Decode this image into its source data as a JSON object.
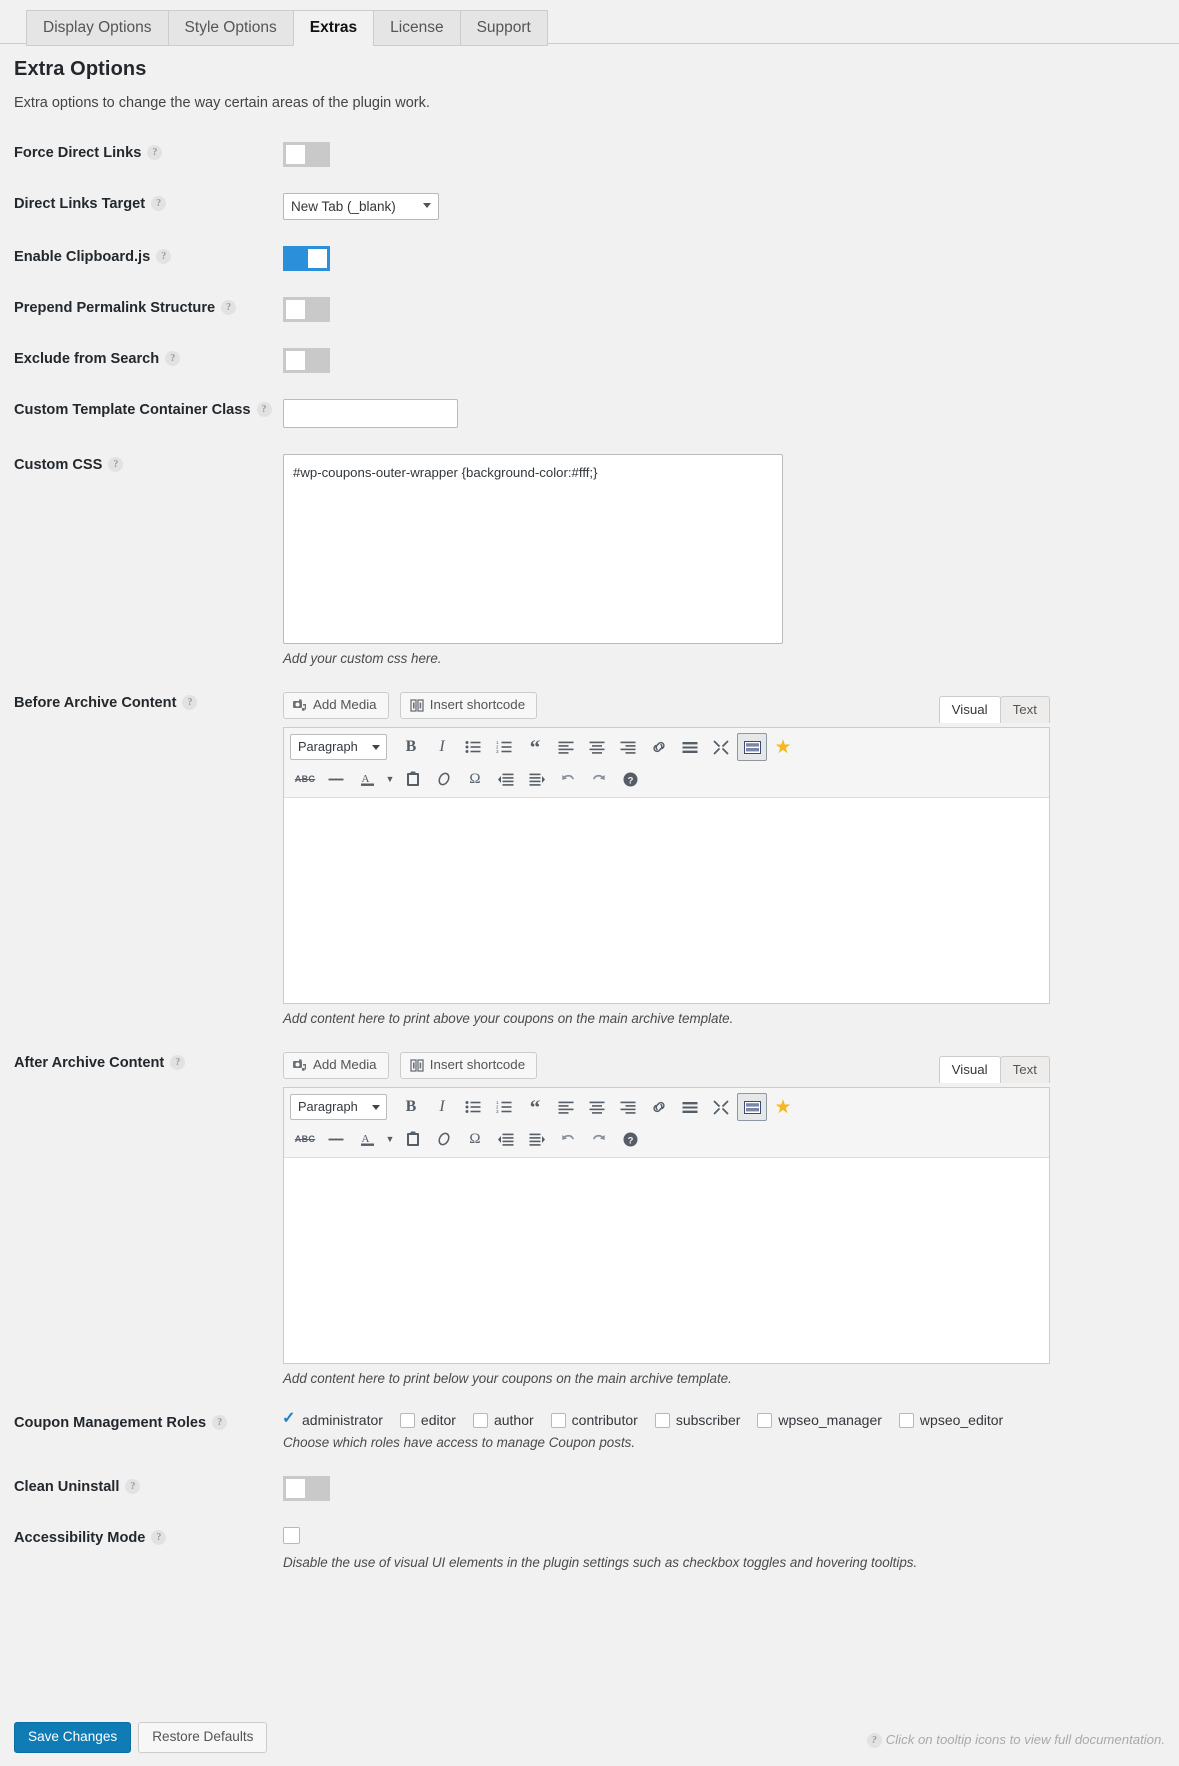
{
  "tabs": [
    {
      "label": "Display Options",
      "active": false
    },
    {
      "label": "Style Options",
      "active": false
    },
    {
      "label": "Extras",
      "active": true
    },
    {
      "label": "License",
      "active": false
    },
    {
      "label": "Support",
      "active": false
    }
  ],
  "page": {
    "title": "Extra Options",
    "subtitle": "Extra options to change the way certain areas of the plugin work."
  },
  "tooltip_glyph": "?",
  "rows": {
    "force_direct_links": {
      "label": "Force Direct Links",
      "state": "off"
    },
    "direct_links_target": {
      "label": "Direct Links Target",
      "value": "New Tab (_blank)"
    },
    "enable_clipboard": {
      "label": "Enable Clipboard.js",
      "state": "on"
    },
    "prepend_permalink": {
      "label": "Prepend Permalink Structure",
      "state": "off"
    },
    "exclude_from_search": {
      "label": "Exclude from Search",
      "state": "off"
    },
    "custom_template_class": {
      "label": "Custom Template Container Class",
      "value": "",
      "placeholder": ""
    },
    "custom_css": {
      "label": "Custom CSS",
      "value": "#wp-coupons-outer-wrapper {background-color:#fff;}",
      "description": "Add your custom css here."
    },
    "before_archive": {
      "label": "Before Archive Content",
      "description": "Add content here to print above your coupons on the main archive template.",
      "content": ""
    },
    "after_archive": {
      "label": "After Archive Content",
      "description": "Add content here to print below your coupons on the main archive template.",
      "content": ""
    },
    "coupon_roles": {
      "label": "Coupon Management Roles",
      "description": "Choose which roles have access to manage Coupon posts.",
      "options": [
        {
          "label": "administrator",
          "checked": true
        },
        {
          "label": "editor",
          "checked": false
        },
        {
          "label": "author",
          "checked": false
        },
        {
          "label": "contributor",
          "checked": false
        },
        {
          "label": "subscriber",
          "checked": false
        },
        {
          "label": "wpseo_manager",
          "checked": false
        },
        {
          "label": "wpseo_editor",
          "checked": false
        }
      ]
    },
    "clean_uninstall": {
      "label": "Clean Uninstall",
      "state": "off"
    },
    "accessibility_mode": {
      "label": "Accessibility Mode",
      "checked": false,
      "description": "Disable the use of visual UI elements in the plugin settings such as checkbox toggles and hovering tooltips."
    }
  },
  "editor": {
    "add_media_label": "Add Media",
    "insert_shortcode_label": "Insert shortcode",
    "visual_tab": "Visual",
    "text_tab": "Text",
    "format_select": "Paragraph",
    "toolbar_row1": [
      {
        "name": "bold-icon",
        "glyph": "B"
      },
      {
        "name": "italic-icon",
        "glyph": "I"
      },
      {
        "name": "bulleted-list-icon",
        "glyph": "☰"
      },
      {
        "name": "numbered-list-icon",
        "glyph": "☰"
      },
      {
        "name": "blockquote-icon",
        "glyph": "“"
      },
      {
        "name": "align-left-icon",
        "glyph": "≡"
      },
      {
        "name": "align-center-icon",
        "glyph": "≡"
      },
      {
        "name": "align-right-icon",
        "glyph": "≡"
      },
      {
        "name": "insert-link-icon",
        "glyph": "🔗"
      },
      {
        "name": "read-more-icon",
        "glyph": "—"
      },
      {
        "name": "fullscreen-icon",
        "glyph": "✕"
      },
      {
        "name": "toolbar-toggle-icon",
        "glyph": "⌨",
        "active": true
      },
      {
        "name": "star-icon",
        "glyph": "★"
      }
    ],
    "toolbar_row2": [
      {
        "name": "strikethrough-icon",
        "glyph": "ABC"
      },
      {
        "name": "horizontal-line-icon",
        "glyph": "—"
      },
      {
        "name": "text-color-icon",
        "glyph": "A"
      },
      {
        "name": "text-color-chevron-icon",
        "glyph": "▾"
      },
      {
        "name": "paste-as-text-icon",
        "glyph": "📋"
      },
      {
        "name": "clear-formatting-icon",
        "glyph": "⊘"
      },
      {
        "name": "special-character-icon",
        "glyph": "Ω"
      },
      {
        "name": "decrease-indent-icon",
        "glyph": "≡"
      },
      {
        "name": "increase-indent-icon",
        "glyph": "≡"
      },
      {
        "name": "undo-icon",
        "glyph": "↶"
      },
      {
        "name": "redo-icon",
        "glyph": "↷"
      },
      {
        "name": "keyboard-shortcuts-icon",
        "glyph": "?"
      }
    ]
  },
  "footer": {
    "save_label": "Save Changes",
    "restore_label": "Restore Defaults",
    "note": "Click on tooltip icons to view full documentation."
  },
  "colors": {
    "accent": "#2b8fd9",
    "primary_button": "#0f7cb5",
    "star": "#f5b920",
    "background": "#f1f1f1"
  }
}
